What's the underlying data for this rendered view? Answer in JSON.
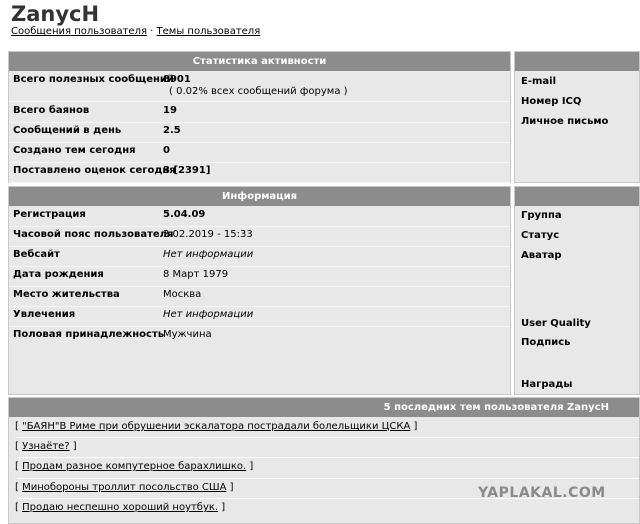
{
  "page": {
    "title": "ZanycH",
    "breadcrumb": {
      "posts_link": "Сообщения пользователя",
      "separator": "·",
      "topics_link": "Темы пользователя"
    }
  },
  "activity": {
    "header": "Статистика активности",
    "rows": [
      {
        "label": "Всего полезных сообщений",
        "value": "8901",
        "sub": "( 0.02% всех сообщений форума )"
      },
      {
        "label": "Всего баянов",
        "value": "19"
      },
      {
        "label": "Сообщений в день",
        "value": "2.5"
      },
      {
        "label": "Создано тем сегодня",
        "value": "0"
      },
      {
        "label": "Поставлено оценок сегодня",
        "value": "3 [2391]"
      }
    ]
  },
  "contact": {
    "labels": [
      "E-mail",
      "Номер ICQ",
      "Личное письмо"
    ]
  },
  "info": {
    "header": "Информация",
    "rows": [
      {
        "label": "Регистрация",
        "value": "5.04.09"
      },
      {
        "label": "Часовой пояс пользователя",
        "value": "3.02.2019 - 15:33"
      },
      {
        "label": "Вебсайт",
        "value": "Нет информации"
      },
      {
        "label": "Дата рождения",
        "value": "8 Март 1979"
      },
      {
        "label": "Место жительства",
        "value": "Москва"
      },
      {
        "label": "Увлечения",
        "value": "Нет информации"
      },
      {
        "label": "Половая принадлежность",
        "value": "Мужчина"
      }
    ]
  },
  "profile": {
    "labels": [
      "Группа",
      "Статус",
      "Аватар",
      "User Quality",
      "Подпись",
      "Награды"
    ]
  },
  "topics": {
    "header": "5 последних тем пользователя ZanycH",
    "items": [
      "\"БАЯН\"В Риме при обрушении эскалатора пострадали болельщики ЦСКА",
      "Узнаёте?",
      "Продам разное компутерное барахлишко.",
      "Минобороны троллит посольство США",
      "Продаю неспешно хороший ноутбук."
    ]
  },
  "watermark": "YAPLAKAL.COM",
  "colors": {
    "header_bg": "#8c8c8c",
    "panel_bg": "#e8e8e8",
    "watermark": "#8a8a8a"
  }
}
